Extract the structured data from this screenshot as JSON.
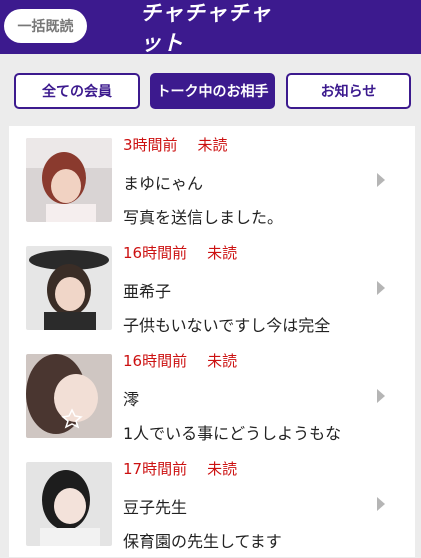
{
  "header": {
    "mark_all_read_label": "一括既読",
    "app_title": "チャチャチャット"
  },
  "tabs": [
    {
      "label": "全ての会員"
    },
    {
      "label": "トーク中のお相手"
    },
    {
      "label": "お知らせ"
    }
  ],
  "colors": {
    "brand": "#3c1a8e",
    "unread": "#cc1111"
  },
  "conversations": [
    {
      "time": "3時間前",
      "status": "未読",
      "name": "まゆにゃん",
      "preview": "写真を送信しました。"
    },
    {
      "time": "16時間前",
      "status": "未読",
      "name": "亜希子",
      "preview": "子供もいないですし今は完全"
    },
    {
      "time": "16時間前",
      "status": "未読",
      "name": "澪",
      "preview": "1人でいる事にどうしようもな"
    },
    {
      "time": "17時間前",
      "status": "未読",
      "name": "豆子先生",
      "preview": "保育園の先生してます"
    }
  ]
}
